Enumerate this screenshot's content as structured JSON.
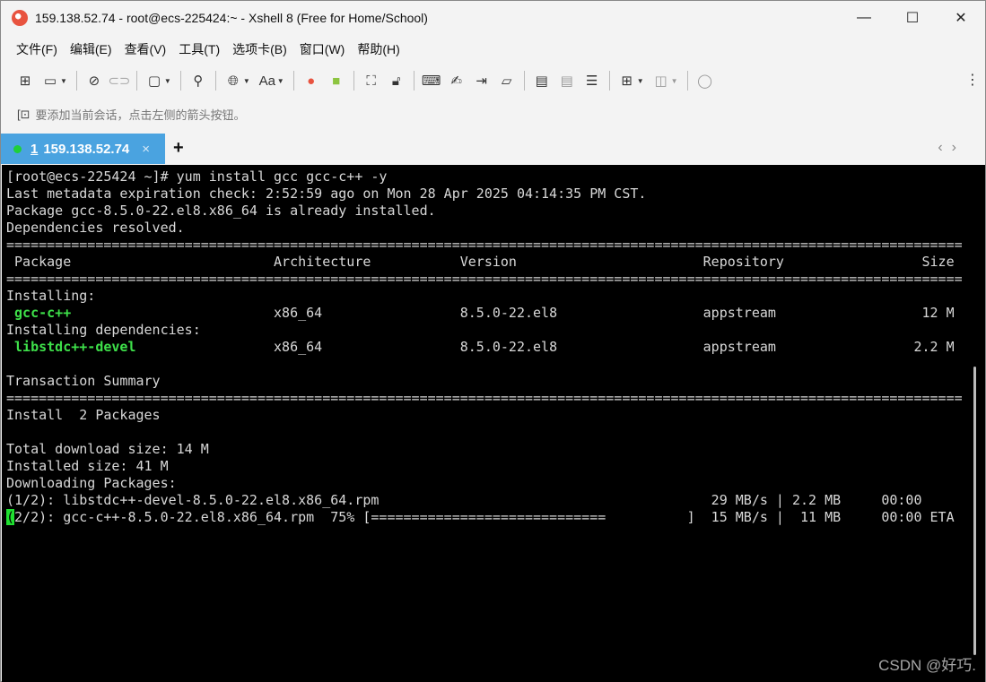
{
  "window": {
    "title": "159.138.52.74 - root@ecs-225424:~ - Xshell 8 (Free for Home/School)",
    "minimize": "—",
    "maximize": "☐",
    "close": "✕"
  },
  "menu": [
    "文件(F)",
    "编辑(E)",
    "查看(V)",
    "工具(T)",
    "选项卡(B)",
    "窗口(W)",
    "帮助(H)"
  ],
  "toolbar": {
    "font_label": "Aa"
  },
  "address_hint": "要添加当前会话，点击左侧的箭头按钮。",
  "tab": {
    "number": "1",
    "label": "159.138.52.74",
    "close": "×",
    "add": "+",
    "nav": "‹›"
  },
  "terminal": {
    "lines": [
      [
        {
          "t": "[root@ecs-225424 ~]# yum install gcc gcc-c++ -y"
        }
      ],
      [
        {
          "t": "Last metadata expiration check: 2:52:59 ago on Mon 28 Apr 2025 04:14:35 PM CST."
        }
      ],
      [
        {
          "t": "Package gcc-8.5.0-22.el8.x86_64 is already installed."
        }
      ],
      [
        {
          "t": "Dependencies resolved."
        }
      ],
      [
        {
          "t": "======================================================================================================================"
        }
      ],
      [
        {
          "t": " Package                         Architecture           Version                       Repository                 Size"
        }
      ],
      [
        {
          "t": "======================================================================================================================"
        }
      ],
      [
        {
          "t": "Installing:"
        }
      ],
      [
        {
          "t": " "
        },
        {
          "t": "gcc-c++",
          "c": "g"
        },
        {
          "t": "                         x86_64                 8.5.0-22.el8                  appstream                  12 M"
        }
      ],
      [
        {
          "t": "Installing dependencies:"
        }
      ],
      [
        {
          "t": " "
        },
        {
          "t": "libstdc++-devel",
          "c": "g"
        },
        {
          "t": "                 x86_64                 8.5.0-22.el8                  appstream                 2.2 M"
        }
      ],
      [
        {
          "t": ""
        }
      ],
      [
        {
          "t": "Transaction Summary"
        }
      ],
      [
        {
          "t": "======================================================================================================================"
        }
      ],
      [
        {
          "t": "Install  2 Packages"
        }
      ],
      [
        {
          "t": ""
        }
      ],
      [
        {
          "t": "Total download size: 14 M"
        }
      ],
      [
        {
          "t": "Installed size: 41 M"
        }
      ],
      [
        {
          "t": "Downloading Packages:"
        }
      ],
      [
        {
          "t": "(1/2): libstdc++-devel-8.5.0-22.el8.x86_64.rpm                                         29 MB/s | 2.2 MB     00:00"
        }
      ],
      [
        {
          "t": "(",
          "c": "cursor"
        },
        {
          "t": "2/2): gcc-c++-8.5.0-22.el8.x86_64.rpm  75% [=============================          ]  15 MB/s |  11 MB     00:00 ETA"
        }
      ]
    ],
    "download_progress_percent": 75
  },
  "watermark": "CSDN @好巧."
}
